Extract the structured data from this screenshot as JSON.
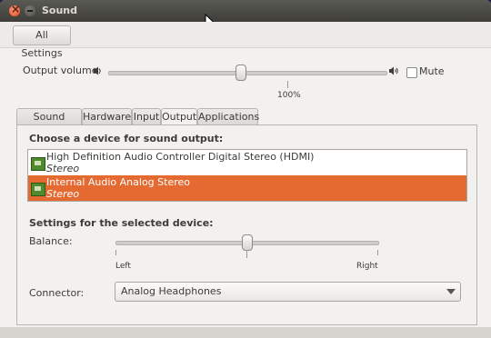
{
  "window": {
    "title": "Sound"
  },
  "toolbar": {
    "all_settings_label": "All Settings"
  },
  "output_volume": {
    "label": "Output volume:",
    "level_percent": 100,
    "percent_label": "100%",
    "mute_label": "Mute",
    "muted": false
  },
  "tabs": [
    {
      "label": "Sound Effects",
      "active": false
    },
    {
      "label": "Hardware",
      "active": false
    },
    {
      "label": "Input",
      "active": false
    },
    {
      "label": "Output",
      "active": true
    },
    {
      "label": "Applications",
      "active": false
    }
  ],
  "output_panel": {
    "choose_heading": "Choose a device for sound output:",
    "devices": [
      {
        "name": "High Definition Audio Controller Digital Stereo (HDMI)",
        "profile": "Stereo",
        "selected": false
      },
      {
        "name": "Internal Audio Analog Stereo",
        "profile": "Stereo",
        "selected": true
      }
    ],
    "settings_heading": "Settings for the selected device:",
    "balance": {
      "label": "Balance:",
      "left_label": "Left",
      "right_label": "Right",
      "value": 0.5
    },
    "connector": {
      "label": "Connector:",
      "value": "Analog Headphones"
    }
  },
  "colors": {
    "selection": "#e56a32",
    "titlebar": "#3e3d39"
  },
  "icons": [
    "close-icon",
    "minimize-icon",
    "speaker-low-icon",
    "speaker-high-icon",
    "sound-card-icon",
    "chevron-down-icon"
  ]
}
